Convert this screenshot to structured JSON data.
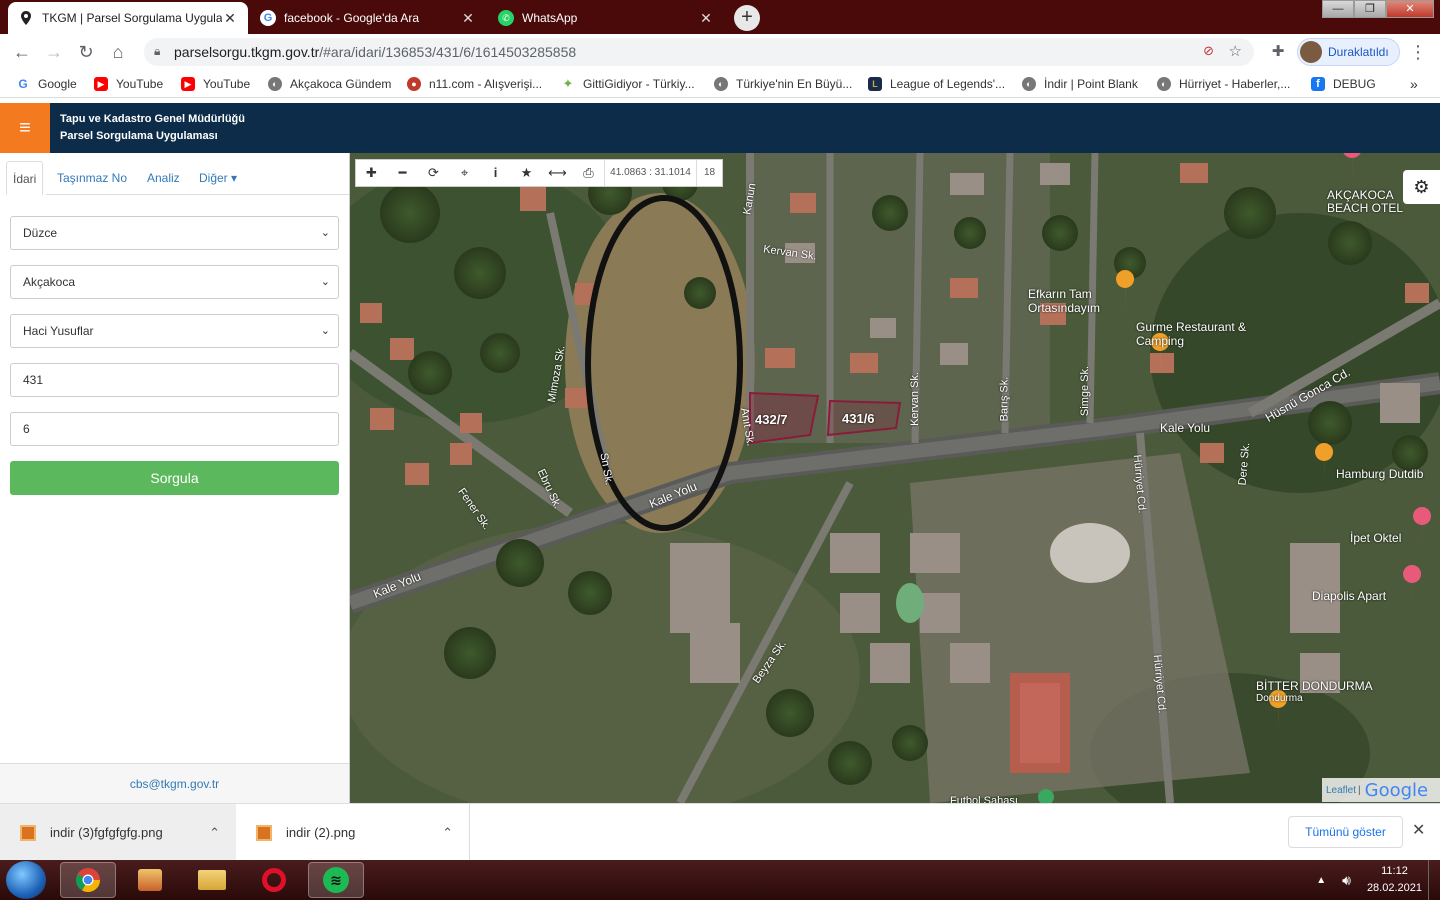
{
  "browser": {
    "tabs": [
      {
        "title": "TKGM | Parsel Sorgulama Uygula",
        "icon": "location-pin-icon",
        "active": true
      },
      {
        "title": "facebook - Google'da Ara",
        "icon": "google-icon",
        "active": false
      },
      {
        "title": "WhatsApp",
        "icon": "whatsapp-icon",
        "active": false
      }
    ],
    "new_tab": "+",
    "close_glyph": "✕",
    "url_host": "parselsorgu.tkgm.gov.tr",
    "url_path": "/#ara/idari/136853/431/6/1614503285858",
    "profile_status": "Duraklatıldı",
    "bookmarks": [
      {
        "label": "Google",
        "color": "#4285f4",
        "glyph": "G"
      },
      {
        "label": "YouTube",
        "color": "#ff0000",
        "glyph": "▶"
      },
      {
        "label": "YouTube",
        "color": "#ff0000",
        "glyph": "▶"
      },
      {
        "label": "Akçakoca Gündem",
        "color": "#777777",
        "glyph": "◐"
      },
      {
        "label": "n11.com - Alışverişi...",
        "color": "#c0392b",
        "glyph": "●"
      },
      {
        "label": "GittiGidiyor - Türkiy...",
        "color": "#6fb43f",
        "glyph": "✦"
      },
      {
        "label": "Türkiye'nin En Büyü...",
        "color": "#777777",
        "glyph": "◐"
      },
      {
        "label": "League of Legends'...",
        "color": "#1a2b4a",
        "glyph": "L"
      },
      {
        "label": "İndir | Point Blank",
        "color": "#777777",
        "glyph": "◐"
      },
      {
        "label": "Hürriyet - Haberler,...",
        "color": "#777777",
        "glyph": "◐"
      },
      {
        "label": "DEBUG",
        "color": "#1877f2",
        "glyph": "f"
      }
    ],
    "bookmarks_overflow": "»"
  },
  "app": {
    "menu_glyph": "≡",
    "title_line1": "Tapu ve Kadastro Genel Müdürlüğü",
    "title_line2": "Parsel Sorgulama Uygulaması",
    "tabs": [
      "İdari",
      "Taşınmaz No",
      "Analiz",
      "Diğer ▾"
    ],
    "form": {
      "province": "Düzce",
      "district": "Akçakoca",
      "neighborhood": "Haci Yusuflar",
      "block": "431",
      "parcel": "6",
      "submit": "Sorgula"
    },
    "contact": "cbs@tkgm.gov.tr"
  },
  "map": {
    "coordinates": "41.0863 : 31.1014",
    "zoom": "18",
    "parcels": [
      "432/7",
      "431/6"
    ],
    "streets": [
      "Kervan Sk.",
      "Kanun",
      "Mimoza Sk.",
      "Ebru Sk.",
      "Fener Sk.",
      "Kale Yolu",
      "Kale Yolu",
      "Kale Yolu",
      "Kervan Sk.",
      "Barış Sk.",
      "Simge Sk.",
      "Hüsnü Gonca Cd.",
      "Hürriyet Cd.",
      "Hürriyet Cd.",
      "Dere Sk.",
      "Beyza Sk.",
      "Anıt Sk.",
      "Sn Sk."
    ],
    "places": [
      "AKÇAKOCA BEACH OTEL",
      "Efkarın Tam Ortasındayım",
      "Gurme Restaurant & Camping",
      "Hamburg Dutdib",
      "İpet Oktel",
      "Diapolis Apart",
      "BİTTER DONDURMA",
      "Dondurma",
      "Futbol Sahası"
    ],
    "attribution_leaflet": "Leaflet",
    "attribution_google": "Google"
  },
  "downloads": {
    "items": [
      "indir (3)fgfgfgfg.png",
      "indir (2).png"
    ],
    "show_all": "Tümünü göster"
  },
  "taskbar": {
    "time": "11:12",
    "date": "28.02.2021"
  }
}
